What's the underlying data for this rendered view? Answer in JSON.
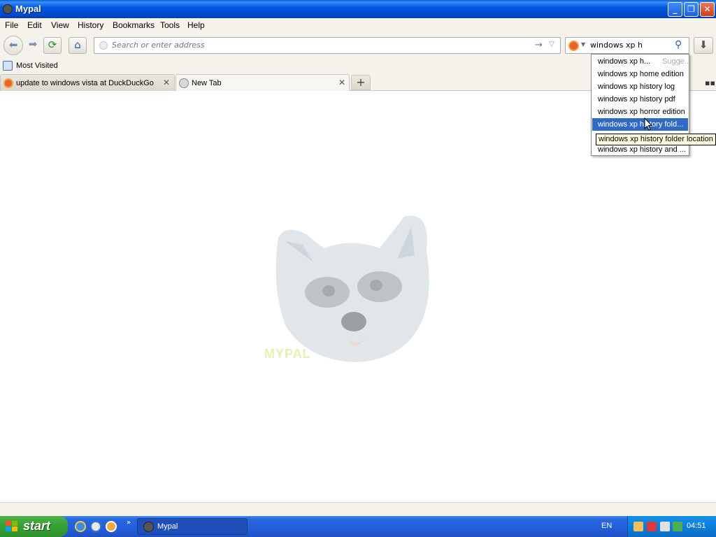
{
  "window": {
    "title": "Mypal"
  },
  "menu": [
    "File",
    "Edit",
    "View",
    "History",
    "Bookmarks",
    "Tools",
    "Help"
  ],
  "toolbar": {
    "url_placeholder": "Search or enter address",
    "search_value": "windows xp h"
  },
  "bookmarks": {
    "most_visited": "Most Visited"
  },
  "tabs": [
    {
      "label": "update to windows vista at DuckDuckGo",
      "selected": false
    },
    {
      "label": "New Tab",
      "selected": true
    }
  ],
  "content": {
    "logo_text": "MYPAL"
  },
  "suggestions": {
    "hint": "Sugge...",
    "items": [
      "windows xp h...",
      "windows xp home edition",
      "windows xp history log",
      "windows xp history pdf",
      "windows xp horror edition",
      "windows xp history fold...",
      "",
      "windows xp history and ..."
    ],
    "selected_index": 5,
    "tooltip": "windows xp history folder location"
  },
  "taskbar": {
    "start_label": "start",
    "task_label": "Mypal",
    "language": "EN",
    "clock": "04:51"
  },
  "colors": {
    "accent": "#316ac5",
    "titlebar": "#0058e0",
    "start": "#38a336"
  }
}
